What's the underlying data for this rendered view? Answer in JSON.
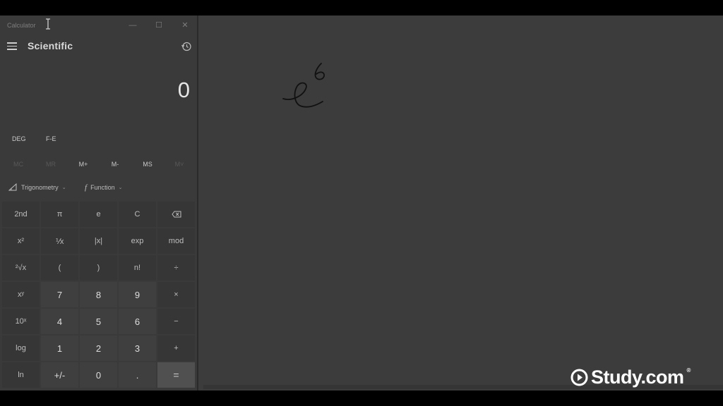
{
  "window": {
    "title": "Calculator",
    "minimize_glyph": "—",
    "maximize_glyph": "☐",
    "close_glyph": "✕"
  },
  "header": {
    "mode": "Scientific",
    "menu_icon": "hamburger-icon",
    "history_icon": "history-icon"
  },
  "display": {
    "value": "0"
  },
  "angle_row": {
    "angle_unit": "DEG",
    "format": "F-E"
  },
  "memory_row": [
    "MC",
    "MR",
    "M+",
    "M-",
    "MS",
    "M˅"
  ],
  "function_row": {
    "trigonometry": "Trigonometry",
    "function": "Function",
    "function_glyph": "f",
    "chevron": "⌄"
  },
  "keys": {
    "r1": [
      "2nd",
      "π",
      "e",
      "C",
      "⌫"
    ],
    "r2": [
      "x²",
      "⅟x",
      "|x|",
      "exp",
      "mod"
    ],
    "r3": [
      "²√x",
      "(",
      ")",
      "n!",
      "÷"
    ],
    "r4": [
      "xʸ",
      "7",
      "8",
      "9",
      "×"
    ],
    "r5": [
      "10ˣ",
      "4",
      "5",
      "6",
      "−"
    ],
    "r6": [
      "log",
      "1",
      "2",
      "3",
      "+"
    ],
    "r7": [
      "ln",
      "+/-",
      "0",
      ".",
      "="
    ]
  },
  "board": {
    "handwriting_base": "e",
    "handwriting_exponent": "6"
  },
  "brand": {
    "name": "Study.com",
    "trademark": "®"
  },
  "colors": {
    "background": "#3c3c3c",
    "calculator_bg": "#3a3a3a",
    "number_key": "#3f3f3f",
    "function_key": "#363636",
    "equals_key": "#505050"
  }
}
